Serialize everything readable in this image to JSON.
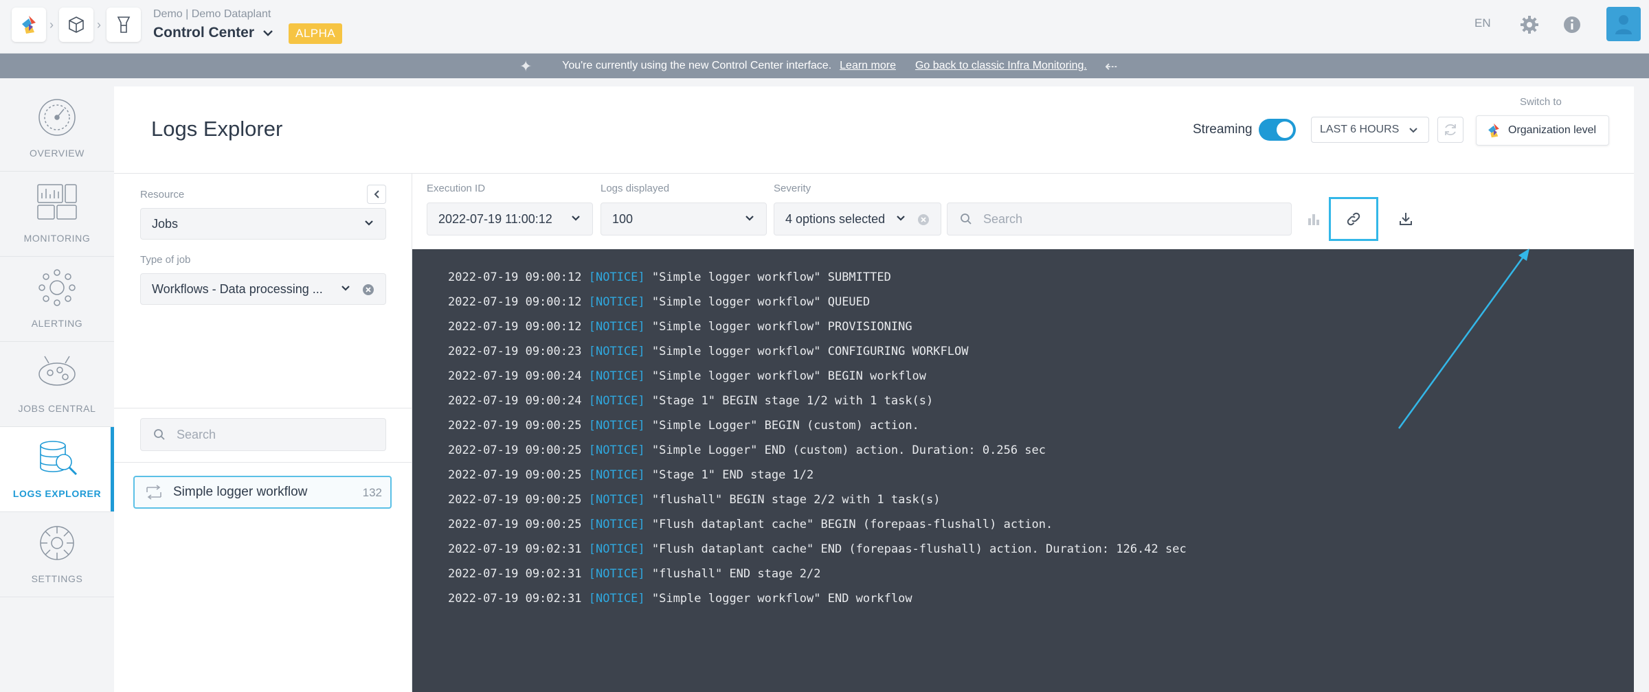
{
  "header": {
    "breadcrumb_icons": [
      "dataplant-logo-icon",
      "cube-icon",
      "control-center-icon"
    ],
    "subtitle": "Demo | Demo Dataplant",
    "title": "Control Center",
    "badge": "ALPHA",
    "language": "EN",
    "icons": [
      "gear-icon",
      "info-icon",
      "avatar-icon"
    ]
  },
  "banner": {
    "text": "You're currently using the new Control Center interface.",
    "learn_more": "Learn more",
    "go_back": "Go back to classic Infra Monitoring."
  },
  "nav": {
    "items": [
      {
        "label": "OVERVIEW",
        "icon": "gauge-icon"
      },
      {
        "label": "MONITORING",
        "icon": "monitoring-icon"
      },
      {
        "label": "ALERTING",
        "icon": "alerting-icon"
      },
      {
        "label": "JOBS CENTRAL",
        "icon": "jobs-icon"
      },
      {
        "label": "LOGS EXPLORER",
        "icon": "logs-explorer-icon",
        "active": true
      },
      {
        "label": "SETTINGS",
        "icon": "settings-gear-icon"
      }
    ]
  },
  "page": {
    "title": "Logs Explorer",
    "streaming_label": "Streaming",
    "streaming_on": true,
    "time_range": "LAST 6 HOURS",
    "switch_to": "Switch to",
    "org_level": "Organization level"
  },
  "filters": {
    "resource_label": "Resource",
    "resource_value": "Jobs",
    "job_type_label": "Type of job",
    "job_type_value": "Workflows - Data processing ...",
    "search_placeholder": "Search",
    "selected_item": {
      "name": "Simple logger workflow",
      "count": "132"
    }
  },
  "toolbar": {
    "execution_label": "Execution ID",
    "execution_value": "2022-07-19 11:00:12",
    "logs_label": "Logs displayed",
    "logs_value": "100",
    "severity_label": "Severity",
    "severity_value": "4 options selected",
    "search_placeholder": "Search",
    "actions": [
      "bar-chart-icon",
      "link-icon",
      "download-icon"
    ]
  },
  "colors": {
    "accent": "#1e9ad6",
    "terminal_bg": "#3d434d",
    "notice": "#2fa9e0",
    "badge": "#f6c443"
  },
  "logs": [
    {
      "ts": "2022-07-19 09:00:12",
      "sev": "[NOTICE]",
      "msg": "\"Simple logger workflow\" SUBMITTED"
    },
    {
      "ts": "2022-07-19 09:00:12",
      "sev": "[NOTICE]",
      "msg": "\"Simple logger workflow\" QUEUED"
    },
    {
      "ts": "2022-07-19 09:00:12",
      "sev": "[NOTICE]",
      "msg": "\"Simple logger workflow\" PROVISIONING"
    },
    {
      "ts": "2022-07-19 09:00:23",
      "sev": "[NOTICE]",
      "msg": "\"Simple logger workflow\" CONFIGURING WORKFLOW"
    },
    {
      "ts": "2022-07-19 09:00:24",
      "sev": "[NOTICE]",
      "msg": "\"Simple logger workflow\" BEGIN workflow"
    },
    {
      "ts": "2022-07-19 09:00:24",
      "sev": "[NOTICE]",
      "msg": "\"Stage 1\" BEGIN stage 1/2 with 1 task(s)"
    },
    {
      "ts": "2022-07-19 09:00:25",
      "sev": "[NOTICE]",
      "msg": "\"Simple Logger\" BEGIN (custom) action."
    },
    {
      "ts": "2022-07-19 09:00:25",
      "sev": "[NOTICE]",
      "msg": "\"Simple Logger\" END (custom) action. Duration: 0.256 sec"
    },
    {
      "ts": "2022-07-19 09:00:25",
      "sev": "[NOTICE]",
      "msg": "\"Stage 1\" END stage 1/2"
    },
    {
      "ts": "2022-07-19 09:00:25",
      "sev": "[NOTICE]",
      "msg": "\"flushall\" BEGIN stage 2/2 with 1 task(s)"
    },
    {
      "ts": "2022-07-19 09:00:25",
      "sev": "[NOTICE]",
      "msg": "\"Flush dataplant cache\" BEGIN (forepaas-flushall) action."
    },
    {
      "ts": "2022-07-19 09:02:31",
      "sev": "[NOTICE]",
      "msg": "\"Flush dataplant cache\" END (forepaas-flushall) action. Duration: 126.42 sec"
    },
    {
      "ts": "2022-07-19 09:02:31",
      "sev": "[NOTICE]",
      "msg": "\"flushall\" END stage 2/2"
    },
    {
      "ts": "2022-07-19 09:02:31",
      "sev": "[NOTICE]",
      "msg": "\"Simple logger workflow\" END workflow"
    }
  ]
}
